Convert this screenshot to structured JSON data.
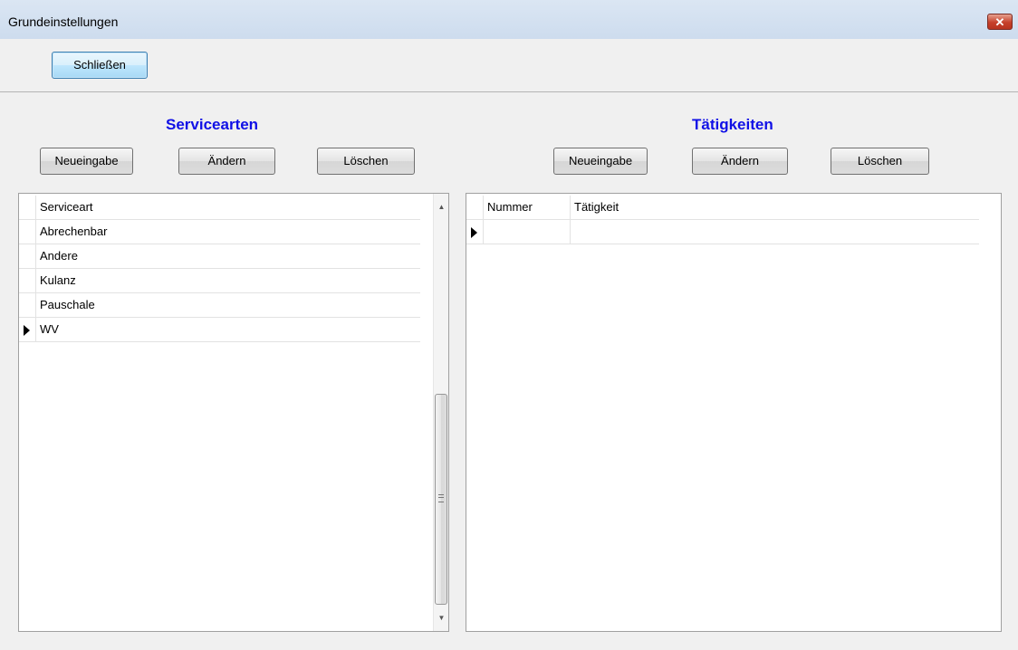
{
  "window": {
    "title": "Grundeinstellungen",
    "close_glyph": "✕"
  },
  "toolbar": {
    "close_label": "Schließen"
  },
  "left": {
    "title": "Servicearten",
    "buttons": {
      "new": "Neueingabe",
      "edit": "Ändern",
      "delete": "Löschen"
    },
    "columns": [
      "Serviceart"
    ],
    "rows": [
      "Abrechenbar",
      "Andere",
      "Kulanz",
      "Pauschale",
      "WV"
    ],
    "selected_row": 4
  },
  "right": {
    "title": "Tätigkeiten",
    "buttons": {
      "new": "Neueingabe",
      "edit": "Ändern",
      "delete": "Löschen"
    },
    "columns": [
      "Nummer",
      "Tätigkeit"
    ],
    "rows": [
      [
        "",
        ""
      ]
    ],
    "selected_row": 0
  },
  "colors": {
    "section_title": "#1010e6",
    "titlebar": "#cddcee",
    "close_button": "#c6402a"
  }
}
